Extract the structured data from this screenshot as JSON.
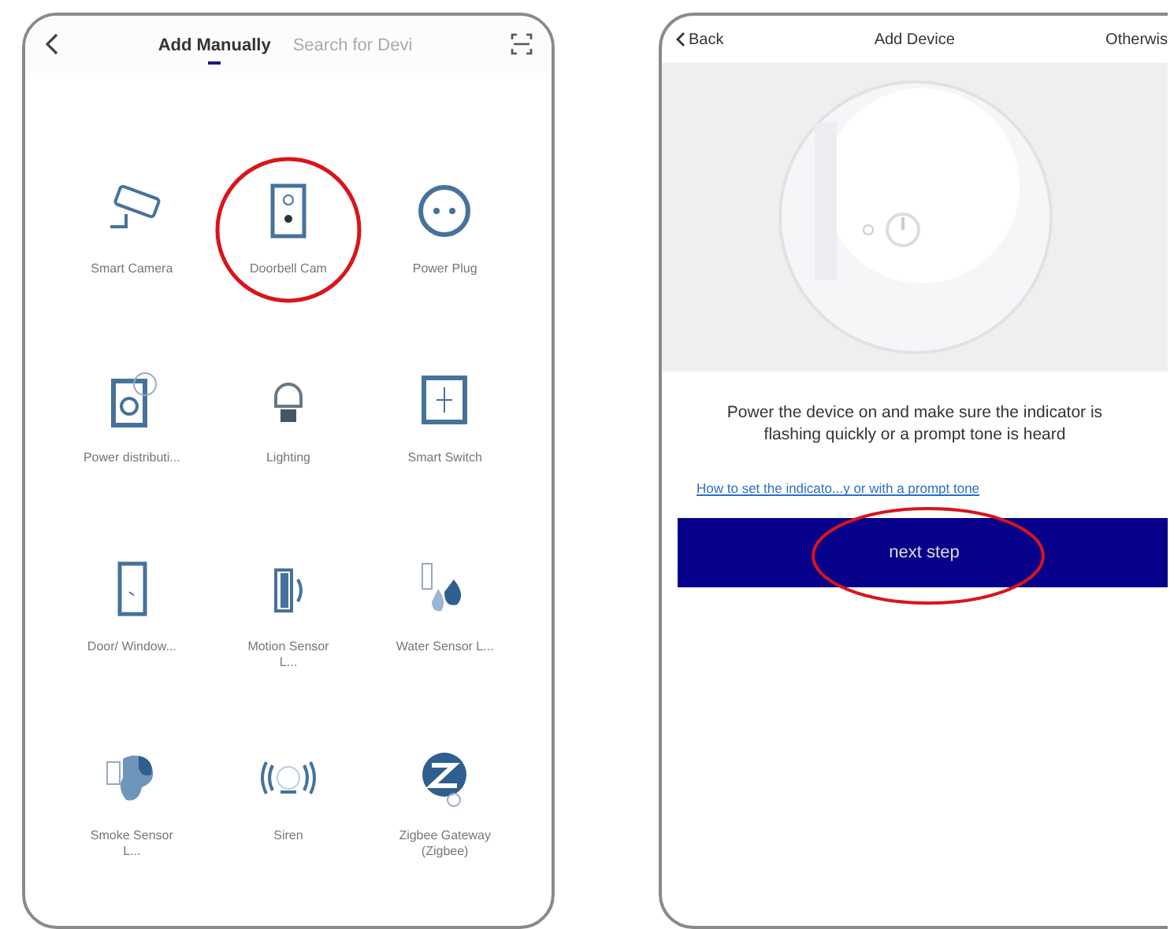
{
  "left_screen": {
    "tabs": [
      {
        "label": "Add Manually",
        "selected": true
      },
      {
        "label": "Search for Devi",
        "selected": false
      }
    ],
    "devices": [
      {
        "label": "Smart Camera",
        "kind": "camera",
        "highlighted": false
      },
      {
        "label": "Doorbell Cam",
        "kind": "doorbell",
        "highlighted": true
      },
      {
        "label": "Power Plug",
        "kind": "plug",
        "highlighted": false
      },
      {
        "label": "Power distributi...",
        "kind": "strip",
        "highlighted": false
      },
      {
        "label": "Lighting",
        "kind": "bulb",
        "highlighted": false
      },
      {
        "label": "Smart Switch",
        "kind": "switch",
        "highlighted": false
      },
      {
        "label": "Door/ Window...",
        "kind": "door",
        "highlighted": false
      },
      {
        "label": "Motion Sensor L...",
        "kind": "motion",
        "highlighted": false
      },
      {
        "label": "Water Sensor L...",
        "kind": "water",
        "highlighted": false
      },
      {
        "label": "Smoke Sensor L...",
        "kind": "smoke",
        "highlighted": false
      },
      {
        "label": "Siren",
        "kind": "siren",
        "highlighted": false
      },
      {
        "label": "Zigbee Gateway (Zigbee)",
        "kind": "zigbee",
        "highlighted": false
      }
    ]
  },
  "right_screen": {
    "back": "Back",
    "title": "Add Device",
    "action": "Otherwis",
    "instruction": "Power the device on and make sure the indicator is flashing quickly or a prompt tone is heard",
    "help_link": "How to set the indicato...y or with a  prompt tone",
    "next_button": {
      "label": "next step",
      "highlighted": true
    }
  }
}
